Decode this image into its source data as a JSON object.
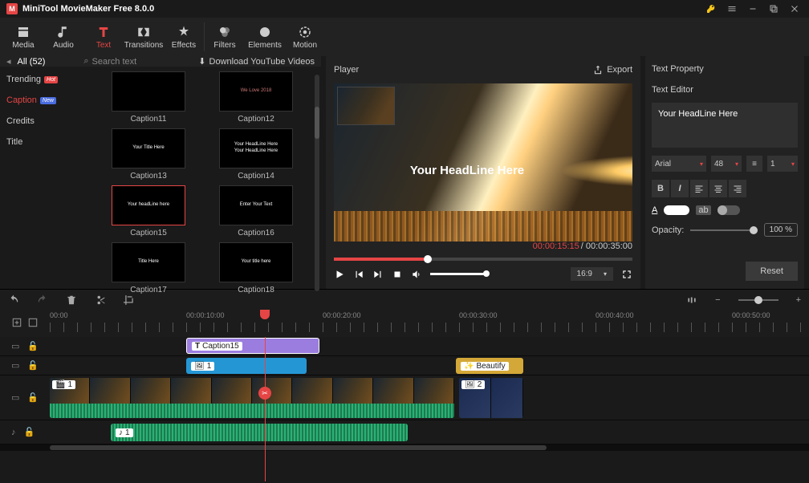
{
  "app": {
    "title": "MiniTool MovieMaker Free 8.0.0"
  },
  "ribbon": {
    "tabs": [
      {
        "label": "Media"
      },
      {
        "label": "Audio"
      },
      {
        "label": "Text"
      },
      {
        "label": "Transitions"
      },
      {
        "label": "Effects"
      },
      {
        "label": "Filters"
      },
      {
        "label": "Elements"
      },
      {
        "label": "Motion"
      }
    ]
  },
  "library": {
    "all_label": "All (52)",
    "search_placeholder": "Search text",
    "download_label": "Download YouTube Videos",
    "sidebar": [
      {
        "label": "Trending",
        "badge": "Hot"
      },
      {
        "label": "Caption",
        "badge": "New"
      },
      {
        "label": "Credits"
      },
      {
        "label": "Title"
      }
    ],
    "thumbs": [
      {
        "label": "Caption11",
        "sample": ""
      },
      {
        "label": "Caption12",
        "sample": "We Love 2018"
      },
      {
        "label": "Caption13",
        "sample": "Your Title Here"
      },
      {
        "label": "Caption14",
        "sample": "Your HeadLine Here\nYour HeadLine Here"
      },
      {
        "label": "Caption15",
        "sample": "Your headLine here"
      },
      {
        "label": "Caption16",
        "sample": "Enter Your Text"
      },
      {
        "label": "Caption17",
        "sample": "Title Here"
      },
      {
        "label": "Caption18",
        "sample": "Your title here"
      }
    ]
  },
  "player": {
    "title": "Player",
    "export": "Export",
    "overlay_text": "Your HeadLine Here",
    "current_time": "00:00:15:15",
    "total_time": "00:00:35:00",
    "aspect": "16:9"
  },
  "props": {
    "title": "Text Property",
    "editor_label": "Text Editor",
    "editor_value": "Your HeadLine Here",
    "font": "Arial",
    "size": "48",
    "lineh_icon": "≡",
    "lineh": "1",
    "opacity_label": "Opacity:",
    "opacity_value": "100 %",
    "reset": "Reset",
    "bold": "B",
    "italic": "I",
    "letterA": "A",
    "ab": "ab"
  },
  "ruler": {
    "labels": [
      "00:00",
      "00:00:10:00",
      "00:00:20:00",
      "00:00:30:00",
      "00:00:40:00",
      "00:00:50:00"
    ]
  },
  "timeline": {
    "text_clip": "Caption15",
    "img_clip": "1",
    "beautify": "Beautify",
    "video_clip": "1",
    "video_clip2": "2",
    "audio_clip": "1"
  }
}
